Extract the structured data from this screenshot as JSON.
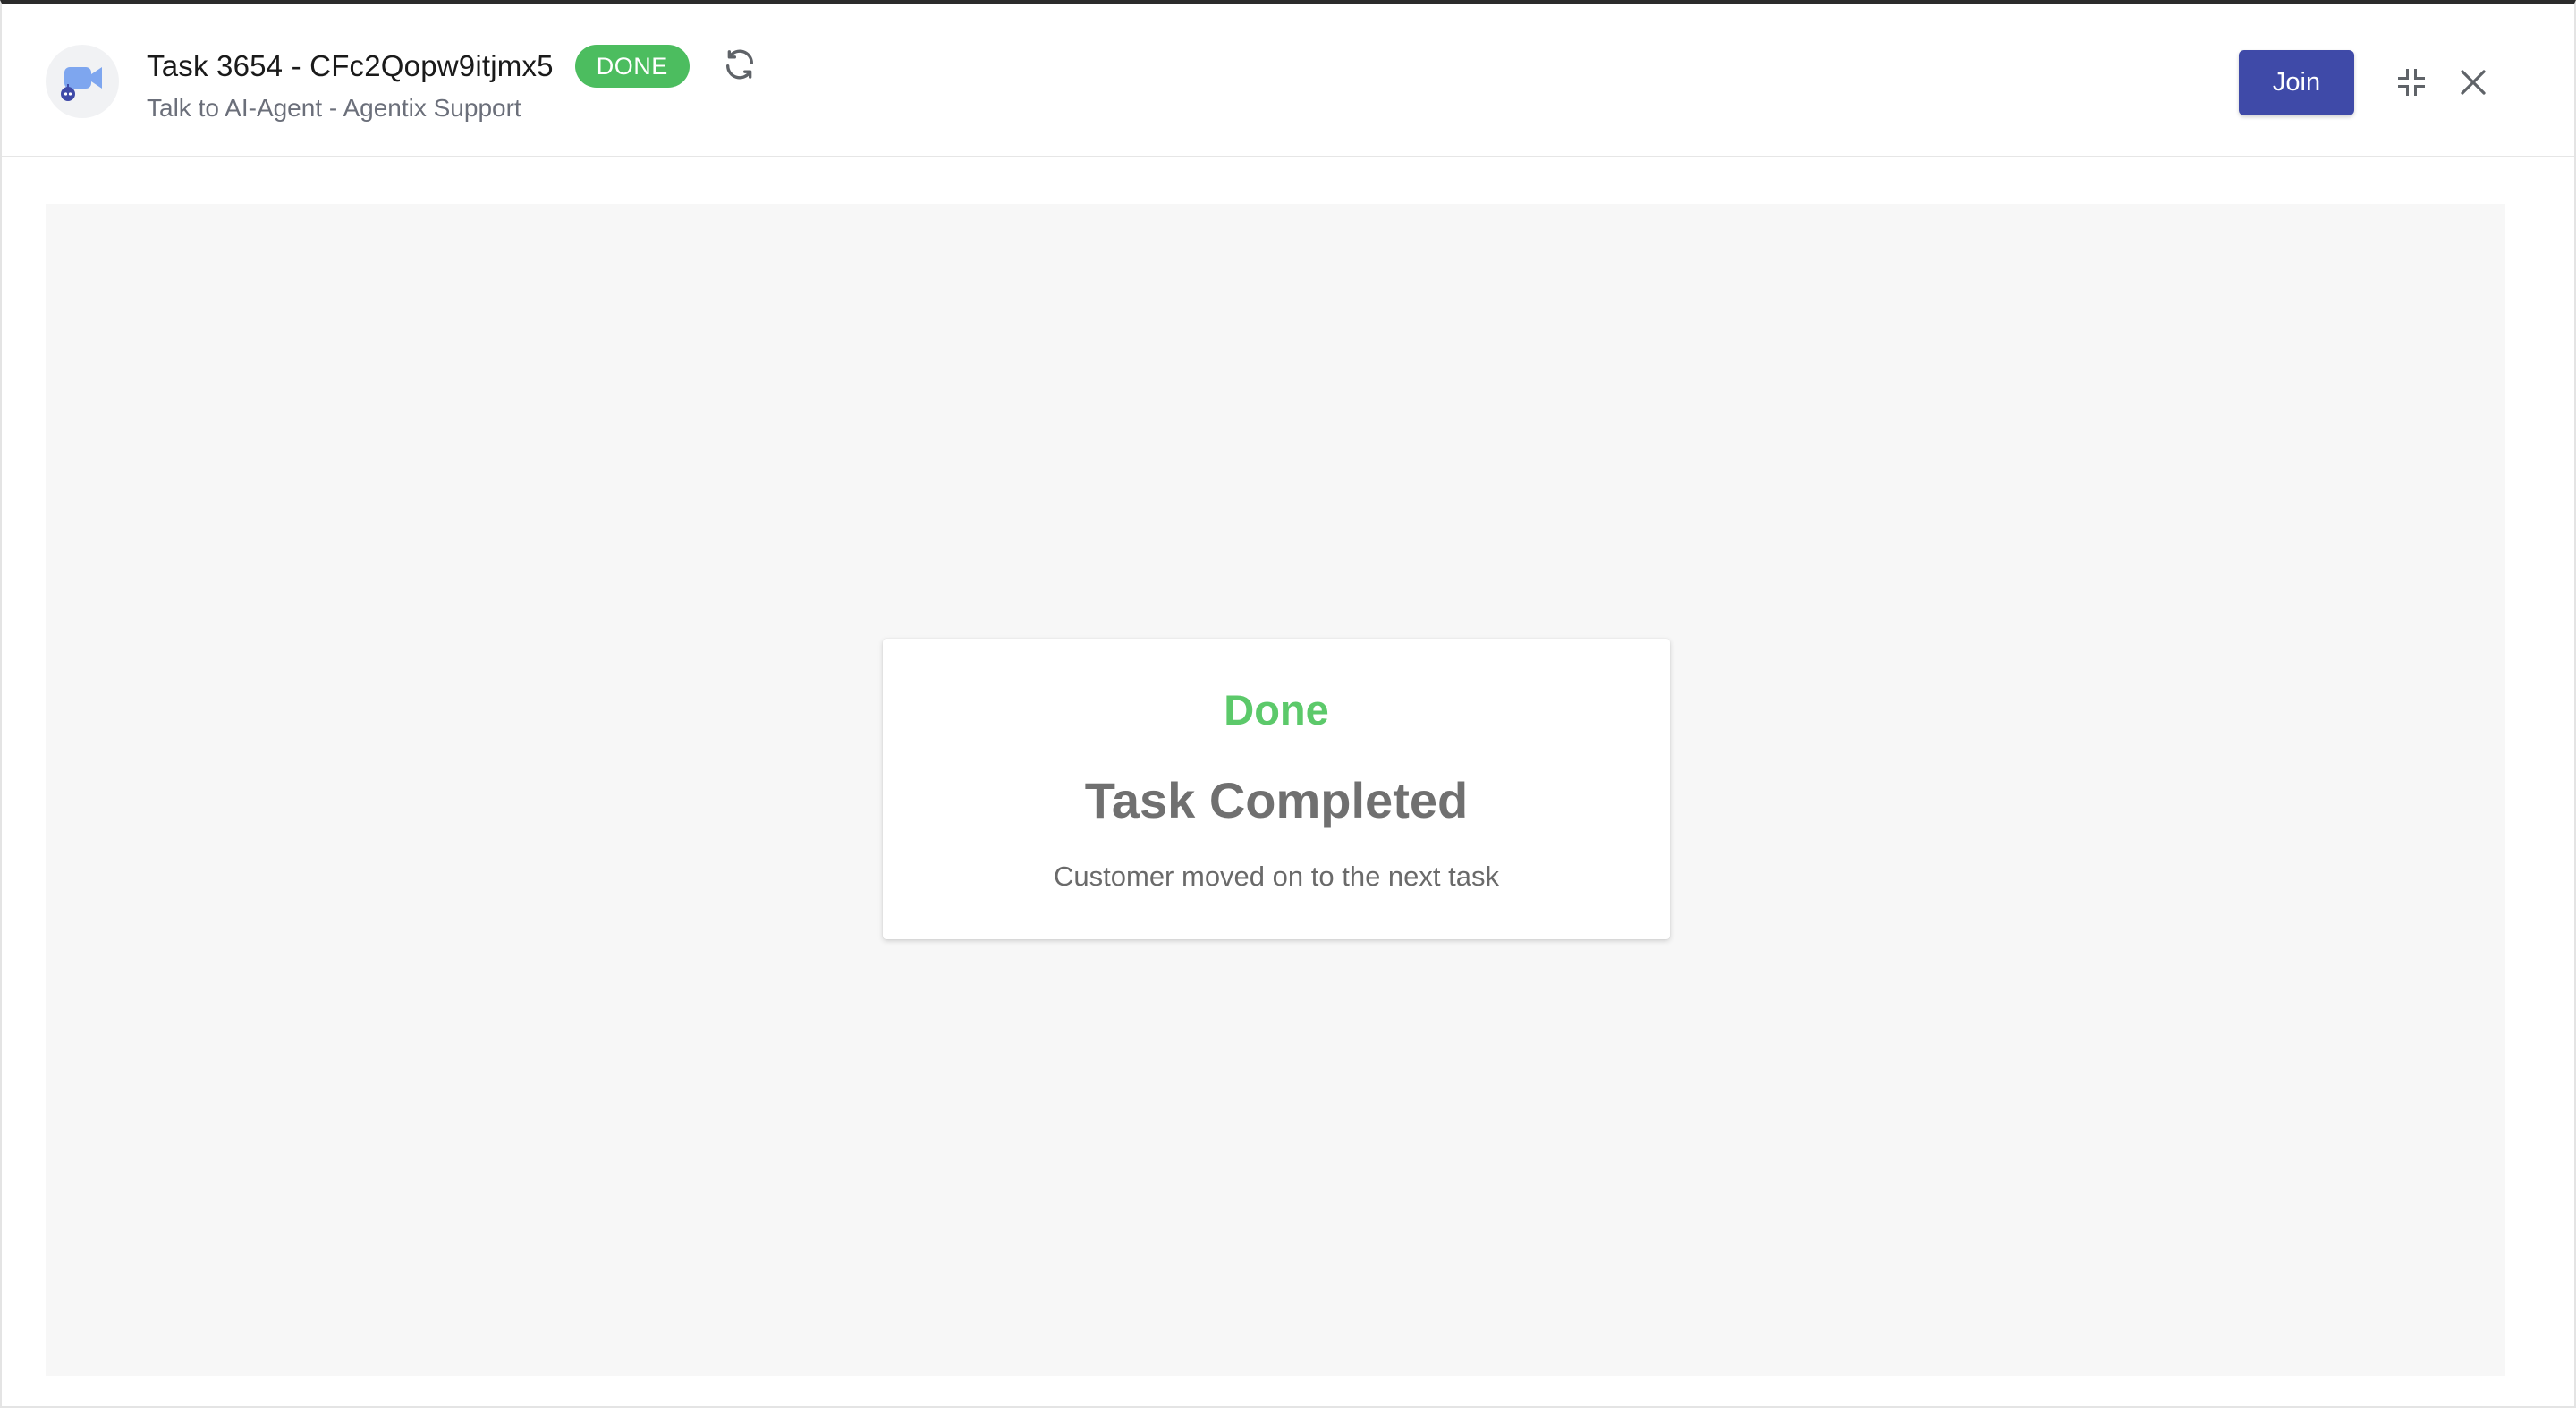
{
  "header": {
    "title": "Task 3654 - CFc2Qopw9itjmx5",
    "status": "DONE",
    "subtitle": "Talk to AI-Agent - Agentix Support",
    "join_label": "Join",
    "icons": {
      "avatar": "video-agent-icon",
      "refresh": "refresh-icon",
      "collapse": "collapse-icon",
      "close": "close-icon"
    }
  },
  "card": {
    "status": "Done",
    "heading": "Task Completed",
    "message": "Customer moved on to the next task"
  },
  "colors": {
    "status_green": "#4cbd5f",
    "done_text_green": "#5cc96a",
    "join_button": "#3f4aa8",
    "avatar_icon_blue": "#7ea6ef",
    "avatar_bot_blue": "#3f4aa8"
  }
}
